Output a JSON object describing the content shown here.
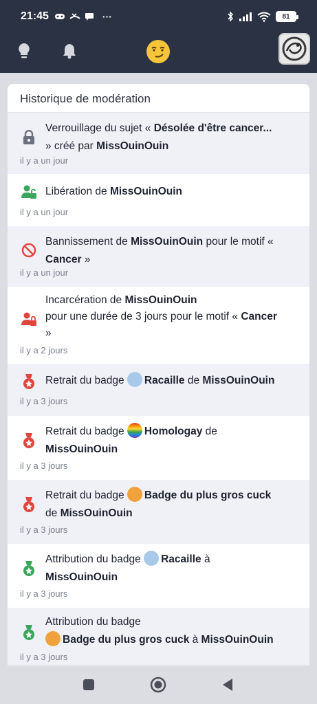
{
  "status": {
    "time": "21:45",
    "dots": "···",
    "battery": "81"
  },
  "nav": {
    "avatar_icon": "dragon-avatar-icon"
  },
  "panel": {
    "title": "Historique de modération"
  },
  "entries": [
    {
      "p1": "Verrouillage du sujet « ",
      "b1": "Désolée d'être cancer...",
      "p2": "» créé par ",
      "b2": "MissOuinOuin",
      "time": "il y a un jour"
    },
    {
      "p1": "Libération de ",
      "b1": "MissOuinOuin",
      "time": "il y a un jour"
    },
    {
      "p1": "Bannissement de ",
      "b1": "MissOuinOuin",
      "p2": " pour le motif «",
      "b2": "Cancer",
      "p3": " »",
      "time": "il y a un jour"
    },
    {
      "p1": "Incarcération de ",
      "b1": "MissOuinOuin",
      "p2": "pour une durée de 3 jours pour le motif « ",
      "b2": "Cancer",
      "p3": "»",
      "time": "il y a 2 jours"
    },
    {
      "p1": "Retrait du badge ",
      "b1": "Racaille",
      "p2": " de ",
      "b2": "MissOuinOuin",
      "time": "il y a 3 jours"
    },
    {
      "p1": "Retrait du badge ",
      "b1": "Homologay",
      "p2": " de",
      "b2": "MissOuinOuin",
      "time": "il y a 3 jours"
    },
    {
      "p1": "Retrait du badge ",
      "b1": "Badge du plus gros cuck",
      "p2": "de ",
      "b2": "MissOuinOuin",
      "time": "il y a 3 jours"
    },
    {
      "p1": "Attribution du badge ",
      "b1": "Racaille",
      "p2": " à",
      "b2": "MissOuinOuin",
      "time": "il y a 3 jours"
    },
    {
      "p1": "Attribution du badge",
      "b1": "Badge du plus gros cuck",
      "p2": " à ",
      "b2": "MissOuinOuin",
      "time": "il y a 3 jours"
    }
  ],
  "colors": {
    "header": "#2b3243",
    "shade": "#eff1f6",
    "green": "#3aa65b",
    "red": "#e0453e",
    "grey": "#6c7080"
  }
}
